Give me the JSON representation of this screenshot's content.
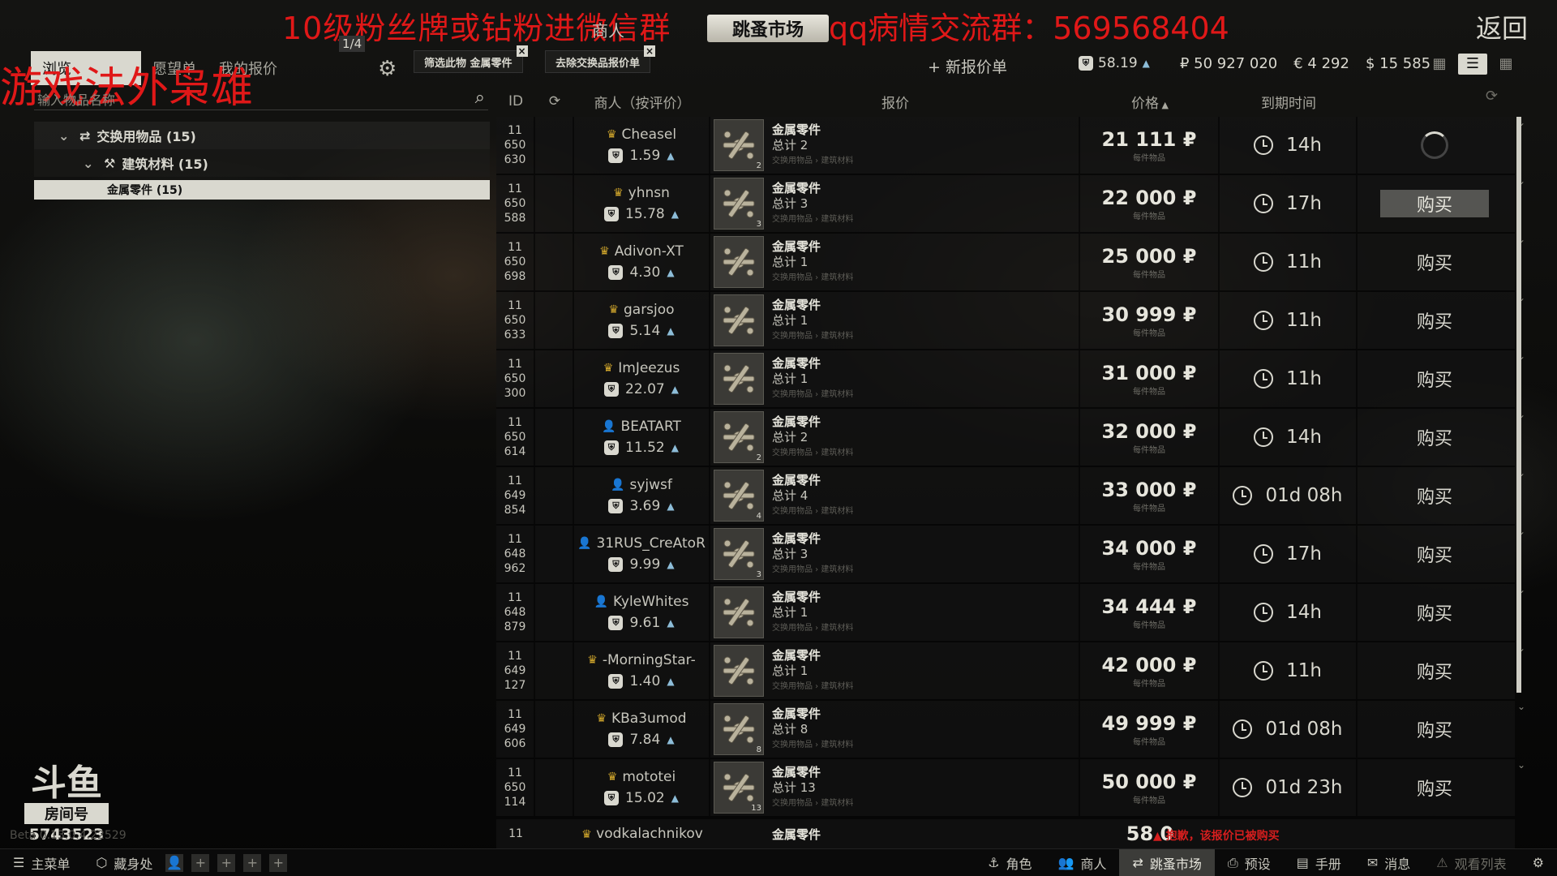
{
  "overlay": {
    "title": "10级粉丝牌或钻粉进微信群",
    "qq": "qq病情交流群：569568404",
    "left": "游戏法外枭雄",
    "market_badge": "跳蚤市场",
    "back": "返回"
  },
  "tabs": {
    "browse": "浏览",
    "wishlist": "愿望单",
    "my_offers": "我的报价",
    "page_indicator": "1/4",
    "trader": "商人"
  },
  "filters": [
    {
      "label": "筛选此物 金属零件"
    },
    {
      "label": "去除交换品报价单"
    }
  ],
  "header_right": {
    "new_offer": "+ 新报价单",
    "rating": "58.19",
    "rub": "₽ 50 927 020",
    "eur": "€ 4 292",
    "usd": "$ 15 585"
  },
  "search": {
    "placeholder": "输入物品名称"
  },
  "tree": {
    "level0": "交换用物品 (15)",
    "level1": "建筑材料 (15)",
    "selected": "金属零件 (15)"
  },
  "columns": {
    "id": "ID",
    "seller": "商人（按评价）",
    "offer": "报价",
    "price": "价格",
    "expires": "到期时间"
  },
  "offers": [
    {
      "id": [
        "11",
        "650",
        "630"
      ],
      "seller": "Cheasel",
      "crown": true,
      "rating": "1.59",
      "item": "金属零件",
      "total": "总计 2",
      "count": "2",
      "path": "交换用物品 › 建筑材料",
      "price": "21 111",
      "per": "每件物品",
      "expires": "14h",
      "buy": "",
      "state": "loading"
    },
    {
      "id": [
        "11",
        "650",
        "588"
      ],
      "seller": "yhnsn",
      "crown": true,
      "rating": "15.78",
      "item": "金属零件",
      "total": "总计 3",
      "count": "3",
      "path": "交换用物品 › 建筑材料",
      "price": "22 000",
      "per": "每件物品",
      "expires": "17h",
      "buy": "购买",
      "state": "hover"
    },
    {
      "id": [
        "11",
        "650",
        "698"
      ],
      "seller": "Adivon-XT",
      "crown": true,
      "rating": "4.30",
      "item": "金属零件",
      "total": "总计 1",
      "count": "",
      "path": "交换用物品 › 建筑材料",
      "price": "25 000",
      "per": "每件物品",
      "expires": "11h",
      "buy": "购买",
      "state": ""
    },
    {
      "id": [
        "11",
        "650",
        "633"
      ],
      "seller": "garsjoo",
      "crown": true,
      "rating": "5.14",
      "item": "金属零件",
      "total": "总计 1",
      "count": "",
      "path": "交换用物品 › 建筑材料",
      "price": "30 999",
      "per": "每件物品",
      "expires": "11h",
      "buy": "购买",
      "state": ""
    },
    {
      "id": [
        "11",
        "650",
        "300"
      ],
      "seller": "ImJeezus",
      "crown": true,
      "rating": "22.07",
      "item": "金属零件",
      "total": "总计 1",
      "count": "",
      "path": "交换用物品 › 建筑材料",
      "price": "31 000",
      "per": "每件物品",
      "expires": "11h",
      "buy": "购买",
      "state": ""
    },
    {
      "id": [
        "11",
        "650",
        "614"
      ],
      "seller": "BEATART",
      "crown": false,
      "rating": "11.52",
      "item": "金属零件",
      "total": "总计 2",
      "count": "2",
      "path": "交换用物品 › 建筑材料",
      "price": "32 000",
      "per": "每件物品",
      "expires": "14h",
      "buy": "购买",
      "state": ""
    },
    {
      "id": [
        "11",
        "649",
        "854"
      ],
      "seller": "syjwsf",
      "crown": false,
      "rating": "3.69",
      "item": "金属零件",
      "total": "总计 4",
      "count": "4",
      "path": "交换用物品 › 建筑材料",
      "price": "33 000",
      "per": "每件物品",
      "expires": "01d 08h",
      "buy": "购买",
      "state": ""
    },
    {
      "id": [
        "11",
        "648",
        "962"
      ],
      "seller": "31RUS_CreAtoR",
      "crown": false,
      "rating": "9.99",
      "item": "金属零件",
      "total": "总计 3",
      "count": "3",
      "path": "交换用物品 › 建筑材料",
      "price": "34 000",
      "per": "每件物品",
      "expires": "17h",
      "buy": "购买",
      "state": ""
    },
    {
      "id": [
        "11",
        "648",
        "879"
      ],
      "seller": "KyleWhites",
      "crown": false,
      "rating": "9.61",
      "item": "金属零件",
      "total": "总计 1",
      "count": "",
      "path": "交换用物品 › 建筑材料",
      "price": "34 444",
      "per": "每件物品",
      "expires": "14h",
      "buy": "购买",
      "state": ""
    },
    {
      "id": [
        "11",
        "649",
        "127"
      ],
      "seller": "-MorningStar-",
      "crown": true,
      "rating": "1.40",
      "item": "金属零件",
      "total": "总计 1",
      "count": "",
      "path": "交换用物品 › 建筑材料",
      "price": "42 000",
      "per": "每件物品",
      "expires": "11h",
      "buy": "购买",
      "state": ""
    },
    {
      "id": [
        "11",
        "649",
        "606"
      ],
      "seller": "KBa3umod",
      "crown": true,
      "rating": "7.84",
      "item": "金属零件",
      "total": "总计 8",
      "count": "8",
      "path": "交换用物品 › 建筑材料",
      "price": "49 999",
      "per": "每件物品",
      "expires": "01d 08h",
      "buy": "购买",
      "state": ""
    },
    {
      "id": [
        "11",
        "650",
        "114"
      ],
      "seller": "mototei",
      "crown": true,
      "rating": "15.02",
      "item": "金属零件",
      "total": "总计 13",
      "count": "13",
      "path": "交换用物品 › 建筑材料",
      "price": "50 000",
      "per": "每件物品",
      "expires": "01d 23h",
      "buy": "购买",
      "state": ""
    }
  ],
  "partial_row": {
    "id": "11",
    "seller": "vodkalachnikov",
    "item": "金属零件",
    "price": "58 0"
  },
  "warning": "抱歉，该报价已被购买",
  "brand": {
    "logo": "斗鱼",
    "room": "房间号",
    "number": "5743523",
    "version": "Beta 0.13.0.4.22529"
  },
  "bottom_bar": {
    "menu": "主菜单",
    "hideout": "藏身处",
    "character": "角色",
    "traders": "商人",
    "flea": "跳蚤市场",
    "presets": "预设",
    "handbook": "手册",
    "messages": "消息",
    "watchlist": "观看列表"
  }
}
